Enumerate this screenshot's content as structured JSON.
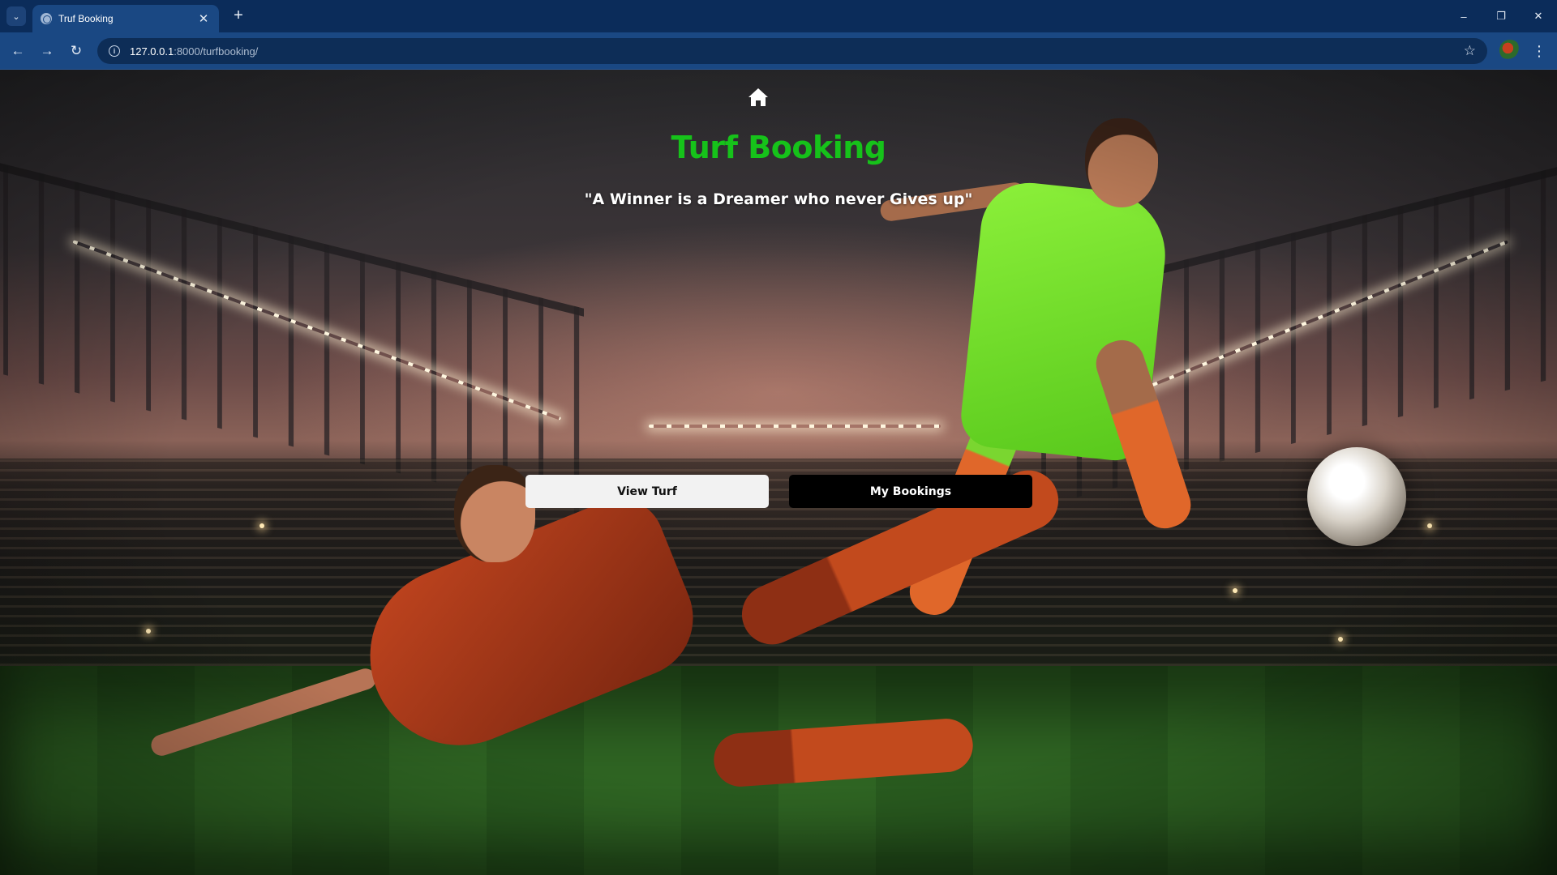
{
  "browser": {
    "tab_title": "Truf Booking",
    "tab_close": "✕",
    "new_tab": "+",
    "url_host": "127.0.0.1",
    "url_path": ":8000/turfbooking/",
    "window_controls": {
      "minimize": "–",
      "restore": "❐",
      "close": "✕"
    },
    "nav": {
      "back": "←",
      "forward": "→",
      "reload": "↻"
    },
    "icons": [
      "search-tabs-icon",
      "site-favicon",
      "info-icon",
      "bookmark-star-icon",
      "profile-avatar",
      "menu-dots-icon"
    ]
  },
  "page": {
    "title": "Turf Booking",
    "tagline": "\"A Winner is a Dreamer who never Gives up\"",
    "buttons": {
      "view_turf": "View Turf",
      "my_bookings": "My Bookings"
    }
  },
  "colors": {
    "title_green": "#16c21a",
    "browser_frame": "#0b2c5a",
    "toolbar": "#1a4883",
    "button_light": "#f2f2f2",
    "button_dark": "#000000"
  }
}
